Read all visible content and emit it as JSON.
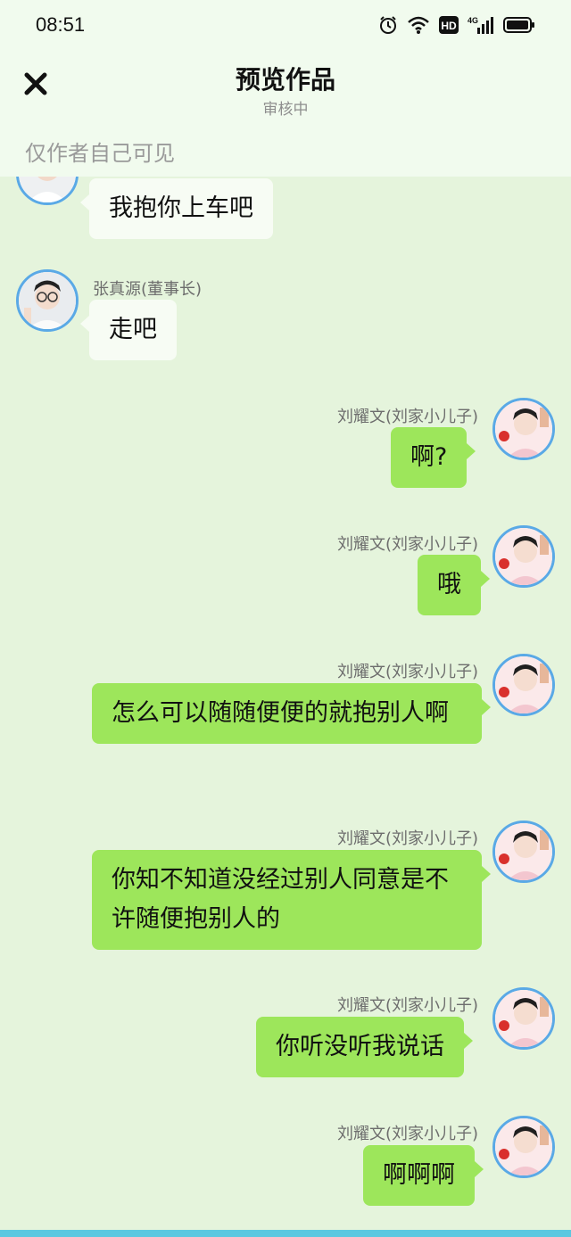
{
  "status": {
    "time": "08:51",
    "icons": [
      "alarm-icon",
      "wifi-icon",
      "hd-icon",
      "signal-4g-icon",
      "battery-icon"
    ],
    "network_label": "4G",
    "hd_label": "HD"
  },
  "header": {
    "title": "预览作品",
    "subtitle": "审核中",
    "visibility_note": "仅作者自己可见"
  },
  "colors": {
    "background": "#e5f4dc",
    "header_bg": "#f1fbee",
    "own_bubble": "#9de65b",
    "other_bubble": "#f7fcf4",
    "avatar_border": "#5aa9e6"
  },
  "messages": [
    {
      "side": "left",
      "name": "",
      "text": "我抱你上车吧"
    },
    {
      "side": "left",
      "name": "张真源(董事长)",
      "text": "走吧"
    },
    {
      "side": "right",
      "name": "刘耀文(刘家小儿子)",
      "text": "啊?"
    },
    {
      "side": "right",
      "name": "刘耀文(刘家小儿子)",
      "text": "哦"
    },
    {
      "side": "right",
      "name": "刘耀文(刘家小儿子)",
      "text": "怎么可以随随便便的就抱别人啊"
    },
    {
      "side": "right",
      "name": "刘耀文(刘家小儿子)",
      "text": "你知不知道没经过别人同意是不许随便抱别人的"
    },
    {
      "side": "right",
      "name": "刘耀文(刘家小儿子)",
      "text": "你听没听我说话"
    },
    {
      "side": "right",
      "name": "刘耀文(刘家小儿子)",
      "text": "啊啊啊"
    }
  ]
}
